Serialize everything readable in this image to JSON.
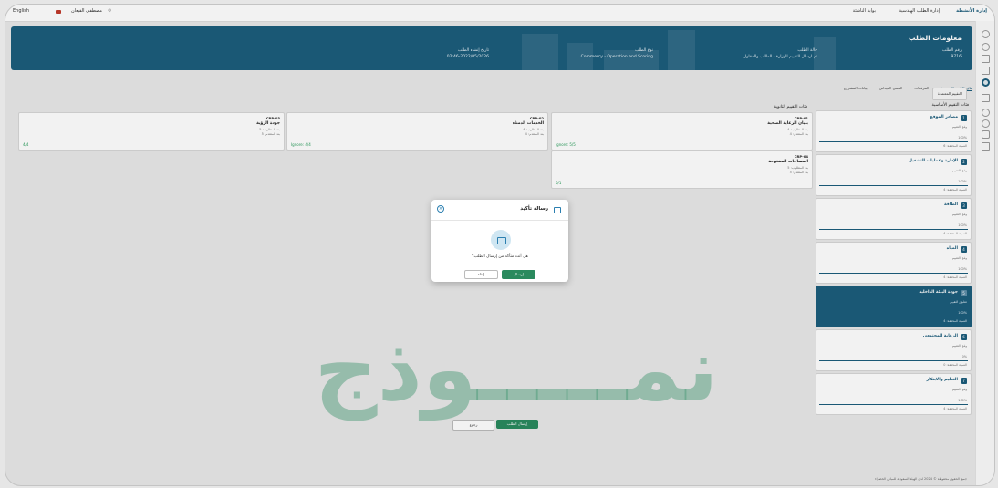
{
  "topbar": {
    "lang": "English",
    "user": "مصطفى القيعان",
    "menu1": "بوابة الناشئة",
    "menu2": "إدارة الطلب الهندسية",
    "brand": "إدارة الأنشطة"
  },
  "hero": {
    "title": "معلومات الطلب",
    "req_label": "رقم الطلب",
    "req_value": "9716",
    "status_label": "حالة الطلب",
    "status_value": "تم ارسال التقييم الوزارة - الطالب والمقاول",
    "type_label": "نوع الطلب",
    "type_value": "Commercy - Operation and Scoring",
    "date_label": "تاريخ إنشاء الطلب",
    "date_value": "02:46-2022/05/2026"
  },
  "tabs": [
    "بيانات المشروع",
    "المسح الميداني",
    "المرفقات",
    "نتائج التقييم المعتمدة"
  ],
  "chip": "التقييم المعتمدة",
  "labels": {
    "main_criteria": "فئات التقييم الأساسية",
    "sub_criteria": "فئات التقييم الثانوية"
  },
  "cards": [
    {
      "code": "CRP-01",
      "name": "بنيان الرعاية الصحية",
      "line1": "بند المطلوب: 4",
      "line2": "بند المتقدم: 4",
      "score": "Ignore: 5/5"
    },
    {
      "code": "CRP-02",
      "name": "الخدمات الدمناء",
      "line1": "بند المطلوب: 4",
      "line2": "بند المتقدم: 4",
      "score": "Ignore: 4/4"
    },
    {
      "code": "CRP-03",
      "name": "جودة الرؤية",
      "line1": "بند المطلوب: 5",
      "line2": "بند المتقدم: 5",
      "score": "4/4"
    },
    {
      "code": "CRP-04",
      "name": "المساحات المفتوحة",
      "line1": "بند المطلوب: 5",
      "line2": "بند المتقدم: 5",
      "score": "0/1"
    }
  ],
  "criteria": [
    {
      "n": "1",
      "name": "مصادر الموقع",
      "s1": "وفق التقييم",
      "s2": "100%",
      "s3": "النسبة المحققة: 6"
    },
    {
      "n": "2",
      "name": "الإدارة وعمليات التشغيل",
      "s1": "وفق التقييم",
      "s2": "100%",
      "s3": "النسبة المحققة: 4"
    },
    {
      "n": "3",
      "name": "الطاقة",
      "s1": "وفق التقييم",
      "s2": "100%",
      "s3": "النسبة المحققة: 4"
    },
    {
      "n": "4",
      "name": "المياه",
      "s1": "وفق التقييم",
      "s2": "100%",
      "s3": "النسبة المحققة: 4"
    },
    {
      "n": "5",
      "name": "جودة البيئة الداخلية",
      "s1": "تطبيق التقييم",
      "s2": "100%",
      "s3": "النسبة المحققة: 4"
    },
    {
      "n": "6",
      "name": "الرعاية المجتمعي",
      "s1": "وفق التقييم",
      "s2": "0%",
      "s3": "النسبة المحققة: 0"
    },
    {
      "n": "7",
      "name": "التعليم والابتكار",
      "s1": "وفق التقييم",
      "s2": "100%",
      "s3": "النسبة المحققة: 4"
    }
  ],
  "watermark": "نمـــــوذج",
  "bottom": {
    "submit": "إرسال الطلب",
    "back": "رجوع"
  },
  "footer": "جميع الحقوق محفوظة © 2024 لدى الهيئة السعودية للمباني الخضراء",
  "modal": {
    "title": "رسالة تأكيد",
    "question": "هل أنت متأكد من إرسال الطلب؟",
    "yes": "إرسال",
    "no": "إلغاء"
  }
}
